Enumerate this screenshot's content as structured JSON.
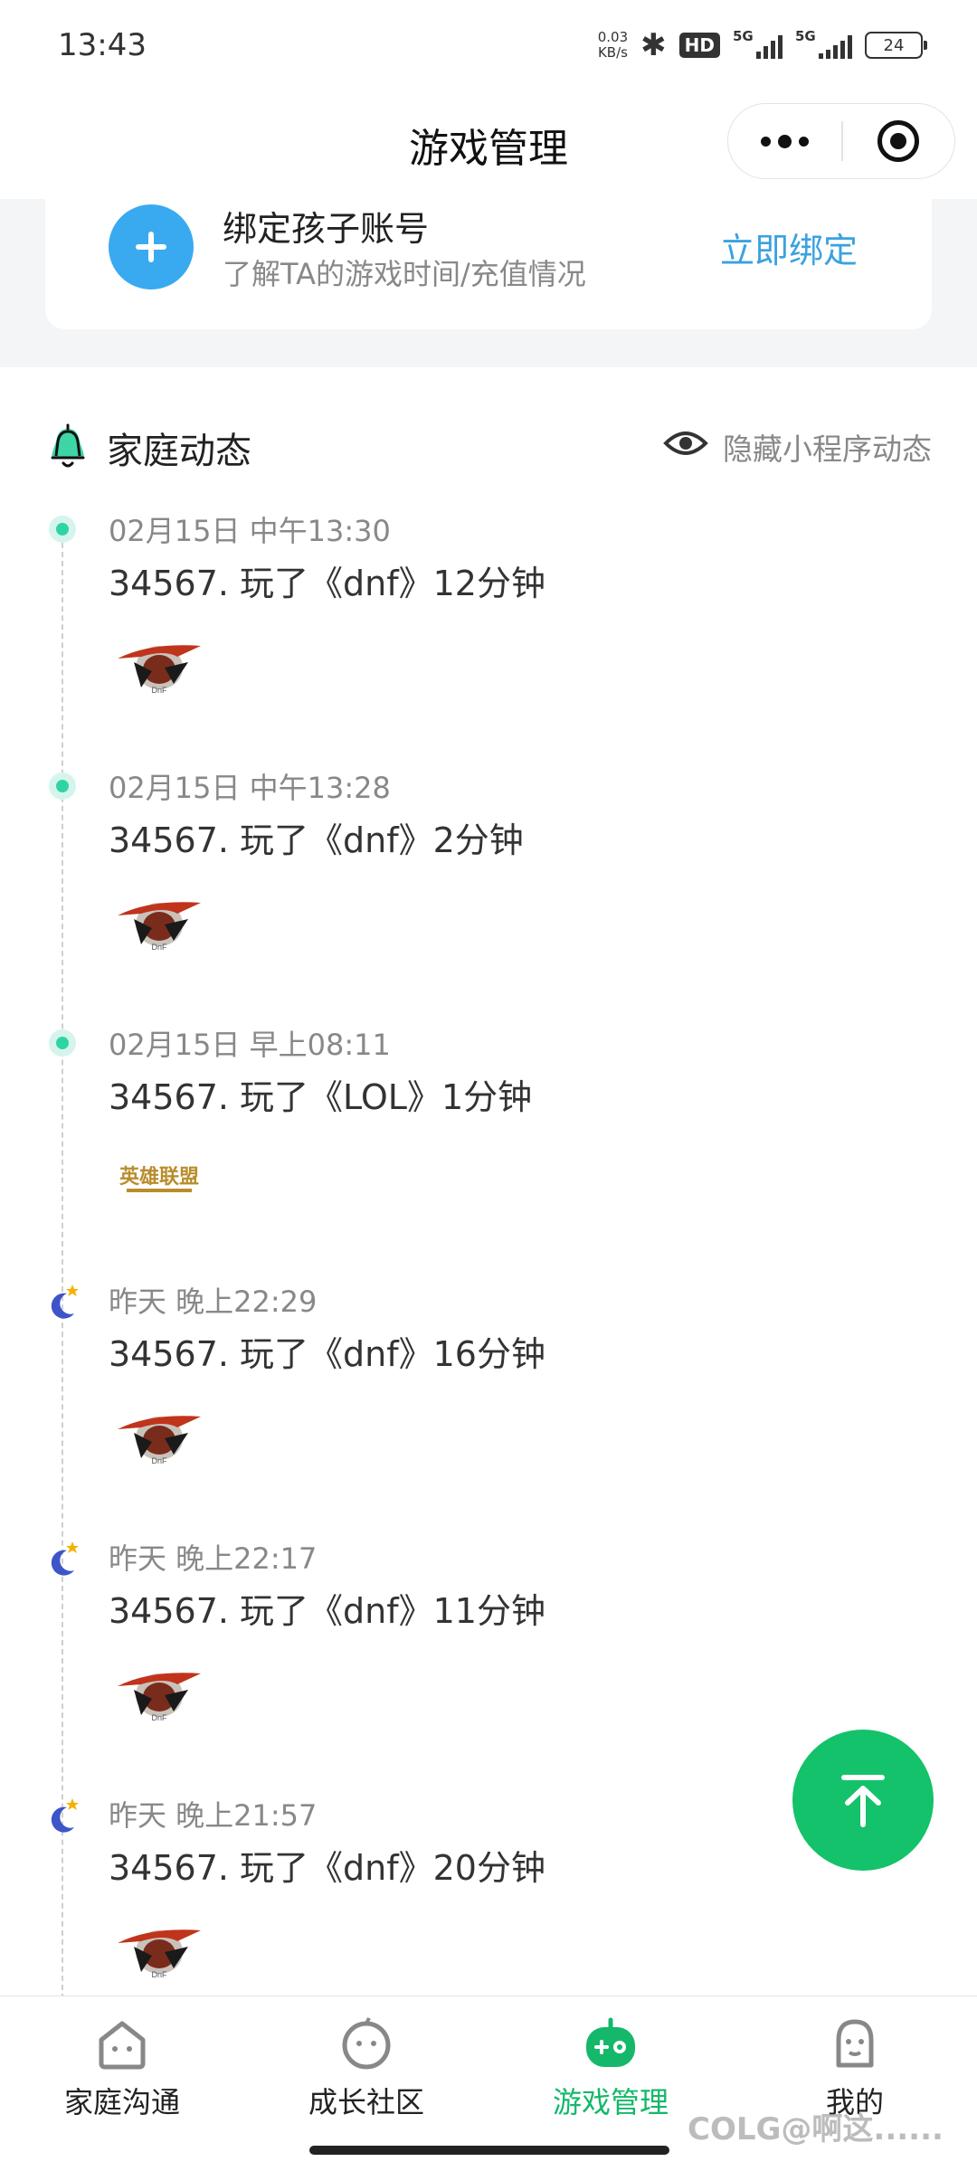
{
  "status_bar": {
    "time": "13:43",
    "net_speed_value": "0.03",
    "net_speed_unit": "KB/s",
    "hd_label": "HD",
    "signal_1_label": "5G",
    "signal_2_label": "5G",
    "battery": "24"
  },
  "header": {
    "title": "游戏管理"
  },
  "bind": {
    "title": "绑定孩子账号",
    "subtitle": "了解TA的游戏时间/充值情况",
    "button": "立即绑定"
  },
  "dynamics": {
    "title": "家庭动态",
    "hide_label": "隐藏小程序动态",
    "entries": [
      {
        "time": "02月15日  中午13:30",
        "text": "34567. 玩了《dnf》12分钟",
        "game": "dnf",
        "period": "day"
      },
      {
        "time": "02月15日  中午13:28",
        "text": "34567. 玩了《dnf》2分钟",
        "game": "dnf",
        "period": "day"
      },
      {
        "time": "02月15日  早上08:11",
        "text": "34567. 玩了《LOL》1分钟",
        "game": "lol",
        "period": "day"
      },
      {
        "time": "昨天  晚上22:29",
        "text": "34567. 玩了《dnf》16分钟",
        "game": "dnf",
        "period": "night"
      },
      {
        "time": "昨天  晚上22:17",
        "text": "34567. 玩了《dnf》11分钟",
        "game": "dnf",
        "period": "night"
      },
      {
        "time": "昨天  晚上21:57",
        "text": "34567. 玩了《dnf》20分钟",
        "game": "dnf",
        "period": "night"
      }
    ]
  },
  "lol_logo_text": "英雄联盟",
  "nav": {
    "items": [
      {
        "label": "家庭沟通",
        "icon": "home-chat-icon"
      },
      {
        "label": "成长社区",
        "icon": "face-icon"
      },
      {
        "label": "游戏管理",
        "icon": "gamepad-icon",
        "active": true
      },
      {
        "label": "我的",
        "icon": "person-icon"
      }
    ]
  },
  "watermark": "COLG@啊这......",
  "colors": {
    "accent_green": "#13c26a",
    "bind_blue": "#3aa2e0",
    "plus_blue": "#39aaf0",
    "dot_green": "#30d4a4"
  }
}
